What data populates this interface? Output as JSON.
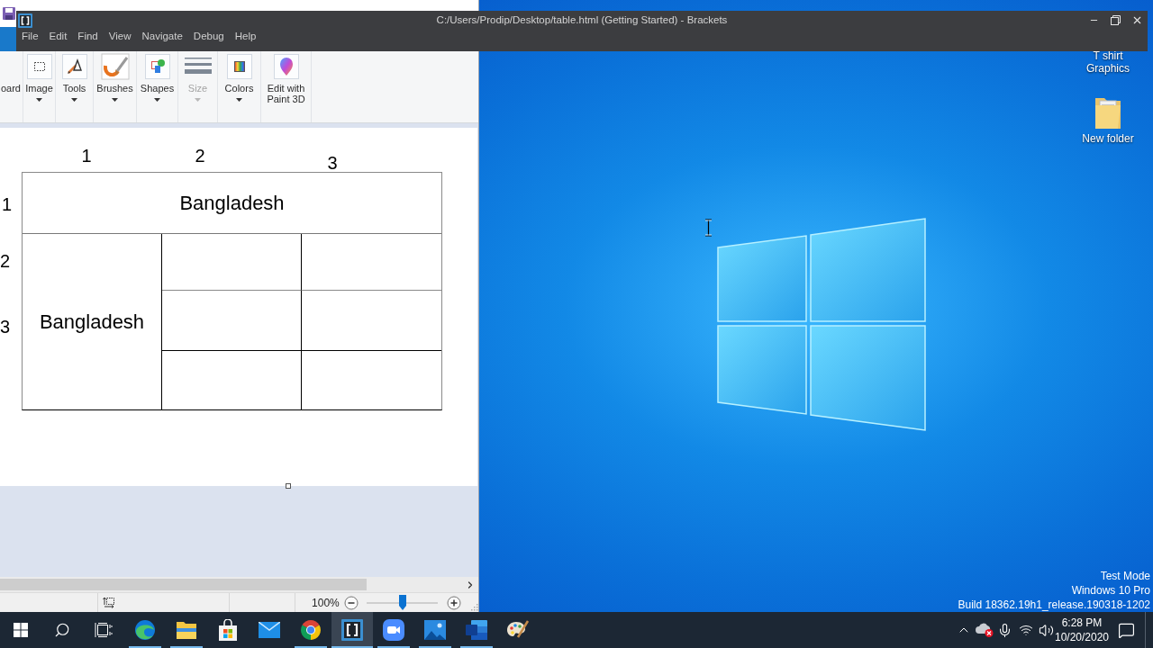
{
  "paint_window": {
    "ribbon": {
      "items": [
        {
          "label": "oard",
          "dropdown": false,
          "disabled": false
        },
        {
          "label": "Image",
          "dropdown": true,
          "disabled": false
        },
        {
          "label": "Tools",
          "dropdown": true,
          "disabled": false
        },
        {
          "label": "Brushes",
          "dropdown": true,
          "disabled": false
        },
        {
          "label": "Shapes",
          "dropdown": true,
          "disabled": false
        },
        {
          "label": "Size",
          "dropdown": true,
          "disabled": true
        },
        {
          "label": "Colors",
          "dropdown": true,
          "disabled": false
        },
        {
          "label": "Edit with Paint 3D",
          "dropdown": false,
          "disabled": false
        }
      ]
    },
    "canvas": {
      "column_numbers": [
        "1",
        "2",
        "3"
      ],
      "row_numbers": [
        "1",
        "2",
        "3"
      ],
      "table": {
        "top_row_text": "Bangladesh",
        "left_column_text": "Bangladesh"
      }
    },
    "status_bar": {
      "zoom": "100%",
      "zoom_slider": {
        "level": 0.5
      }
    }
  },
  "brackets_window": {
    "title": "C:/Users/Prodip/Desktop/table.html (Getting Started) - Brackets",
    "menu": [
      "File",
      "Edit",
      "Find",
      "View",
      "Navigate",
      "Debug",
      "Help"
    ]
  },
  "desktop": {
    "icons": [
      {
        "kind": "covered",
        "label": "T shirt Graphics"
      },
      {
        "kind": "folder",
        "label": "New folder"
      }
    ],
    "watermark": [
      "Test Mode",
      "Windows 10 Pro",
      "Build 18362.19h1_release.190318-1202"
    ]
  },
  "taskbar": {
    "apps": [
      {
        "running": true,
        "selected": false
      },
      {
        "running": true,
        "selected": false
      },
      {
        "running": false,
        "selected": false
      },
      {
        "running": false,
        "selected": false
      },
      {
        "running": true,
        "selected": false
      },
      {
        "running": true,
        "selected": true
      },
      {
        "running": true,
        "selected": false
      },
      {
        "running": true,
        "selected": false
      },
      {
        "running": true,
        "selected": false
      },
      {
        "running": false,
        "selected": false
      }
    ],
    "clock": {
      "time": "6:28 PM",
      "date": "10/20/2020"
    }
  }
}
